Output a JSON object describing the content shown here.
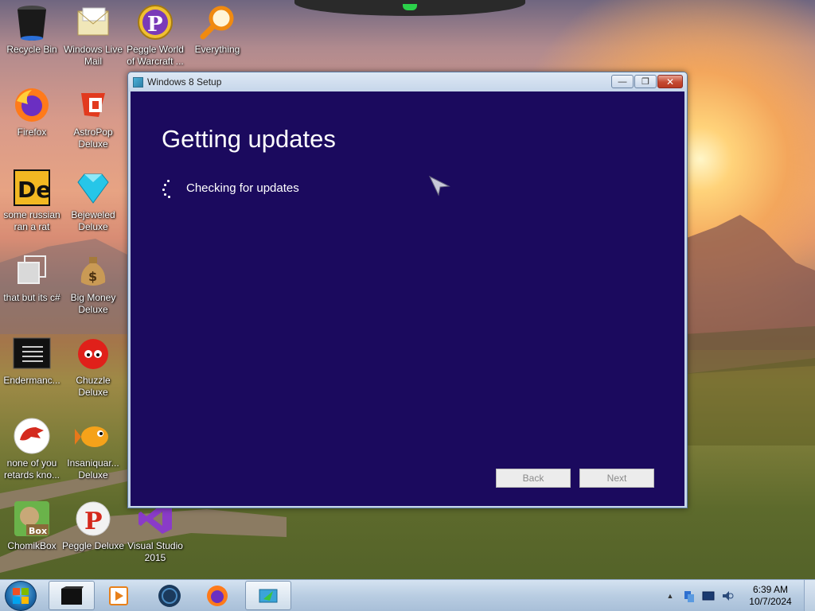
{
  "desktop": {
    "icons": [
      {
        "label": "Recycle Bin",
        "icon": "recycle-bin-icon"
      },
      {
        "label": "Windows Live Mail",
        "icon": "mail-icon"
      },
      {
        "label": "Peggle World of Warcraft ...",
        "icon": "peggle-icon"
      },
      {
        "label": "Everything",
        "icon": "search-icon"
      },
      {
        "label": "Firefox",
        "icon": "firefox-icon"
      },
      {
        "label": "AstroPop Deluxe",
        "icon": "astropop-icon"
      },
      {
        "label": "some russian ran a rat",
        "icon": "de-icon"
      },
      {
        "label": "Bejeweled Deluxe",
        "icon": "gem-icon"
      },
      {
        "label": "that but its c#",
        "icon": "copy-icon"
      },
      {
        "label": "Big Money Deluxe",
        "icon": "money-bag-icon"
      },
      {
        "label": "Endermanc...",
        "icon": "terminal-icon"
      },
      {
        "label": "Chuzzle Deluxe",
        "icon": "chuzzle-icon"
      },
      {
        "label": "none of you retards kno...",
        "icon": "dinosaur-icon"
      },
      {
        "label": "Insaniquar... Deluxe",
        "icon": "fish-icon"
      },
      {
        "label": "ChomikBox",
        "icon": "hamster-icon"
      },
      {
        "label": "Peggle Deluxe",
        "icon": "peggle-icon"
      },
      {
        "label": "Visual Studio 2015",
        "icon": "visual-studio-icon"
      }
    ]
  },
  "window": {
    "title": "Windows 8 Setup",
    "minimize": "—",
    "maximize": "❐",
    "close": "✕",
    "heading": "Getting updates",
    "status": "Checking for updates",
    "back_label": "Back",
    "next_label": "Next"
  },
  "taskbar": {
    "items": [
      "terminal-window-icon",
      "media-player-icon",
      "steam-icon",
      "firefox-icon",
      "setup-icon"
    ],
    "time": "6:39 AM",
    "date": "10/7/2024"
  },
  "colors": {
    "setup_background": "#1b0a5e",
    "taskbar": "#b9cde2"
  }
}
